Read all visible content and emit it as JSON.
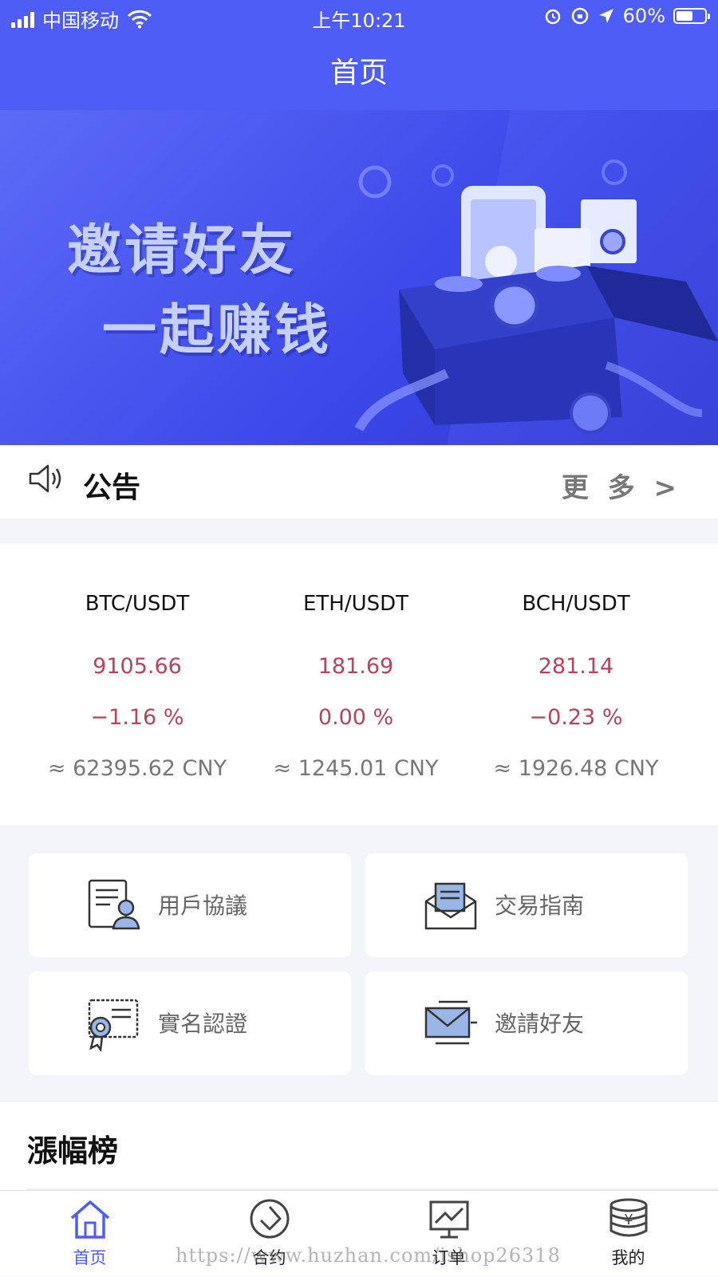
{
  "status_bar": {
    "carrier": "中国移动",
    "time": "上午10:21",
    "battery": "60%",
    "battery_level": 0.6
  },
  "nav": {
    "title": "首页"
  },
  "banner": {
    "line1": "邀请好友",
    "line2": "一起赚钱"
  },
  "notice": {
    "title": "公告",
    "more": "更 多 >"
  },
  "tickers": [
    {
      "pair": "BTC/USDT",
      "price": "9105.66",
      "change": "−1.16 %",
      "cny": "≈ 62395.62 CNY"
    },
    {
      "pair": "ETH/USDT",
      "price": "181.69",
      "change": "0.00 %",
      "cny": "≈ 1245.01 CNY"
    },
    {
      "pair": "BCH/USDT",
      "price": "281.14",
      "change": "−0.23 %",
      "cny": "≈ 1926.48 CNY"
    }
  ],
  "menu": [
    {
      "label": "用戶協議",
      "icon": "user-agreement-icon"
    },
    {
      "label": "交易指南",
      "icon": "trade-guide-icon"
    },
    {
      "label": "實名認證",
      "icon": "certificate-icon"
    },
    {
      "label": "邀請好友",
      "icon": "invite-mail-icon"
    }
  ],
  "ranking": {
    "title": "漲幅榜"
  },
  "tabbar": [
    {
      "label": "首页",
      "icon": "home-icon",
      "active": true
    },
    {
      "label": "合约",
      "icon": "contract-icon",
      "active": false
    },
    {
      "label": "订单",
      "icon": "order-icon",
      "active": false
    },
    {
      "label": "我的",
      "icon": "coins-icon",
      "active": false
    }
  ],
  "watermark": "https://www.huzhan.com/ishop26318",
  "colors": {
    "primary": "#4d5df5",
    "price": "#b34560",
    "muted": "#777777"
  }
}
